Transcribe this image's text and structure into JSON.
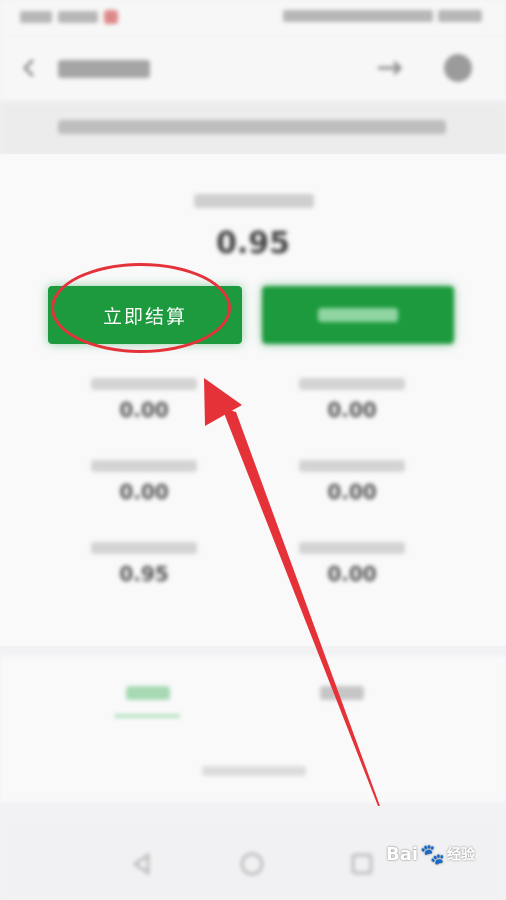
{
  "balance": {
    "value": "0.95"
  },
  "actions": {
    "settle_label": "立即结算"
  },
  "stats": [
    {
      "value": "0.00"
    },
    {
      "value": "0.00"
    },
    {
      "value": "0.00"
    },
    {
      "value": "0.00"
    },
    {
      "value": "0.95"
    },
    {
      "value": "0.00"
    }
  ],
  "watermark": {
    "brand": "Bai",
    "paw": "🐾",
    "suffix": "经验"
  },
  "colors": {
    "primary_green": "#1c9a3d",
    "annotation_red": "#e53238",
    "page_background": "#f2f2f4"
  },
  "icons": {
    "back": "back-arrow-icon",
    "header_action": "share-icon",
    "header_more": "more-icon",
    "nav_back": "triangle-back-icon",
    "nav_home": "circle-home-icon",
    "nav_recent": "square-recent-icon"
  }
}
